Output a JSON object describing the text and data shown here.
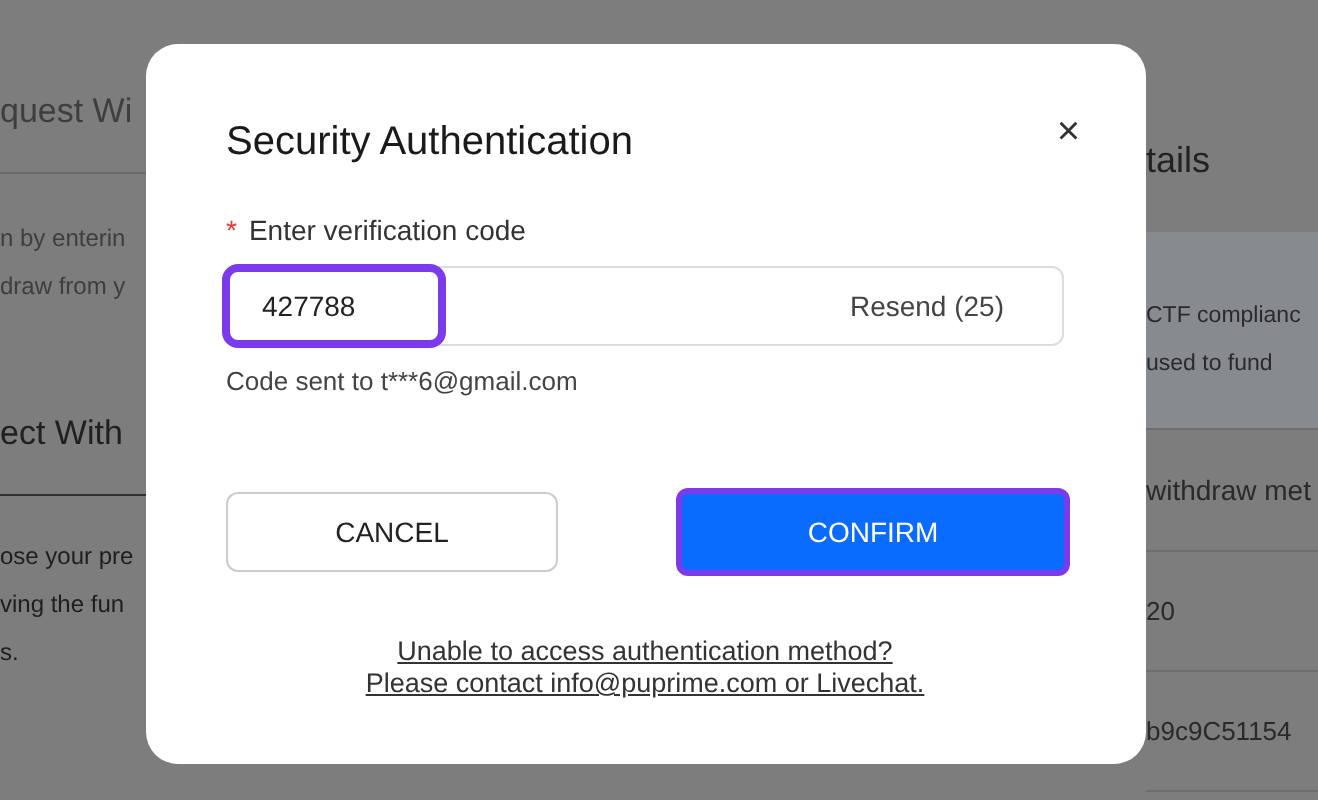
{
  "background": {
    "left": [
      {
        "kind": "heading",
        "text": "quest Wi"
      },
      {
        "kind": "rule"
      },
      {
        "kind": "line",
        "text": "n by enterin"
      },
      {
        "kind": "line",
        "text": "draw from y"
      },
      {
        "kind": "heading",
        "text": "ect With"
      },
      {
        "kind": "rule"
      },
      {
        "kind": "line",
        "text": "ose your pre"
      },
      {
        "kind": "line",
        "text": "ving the fun"
      },
      {
        "kind": "line",
        "text": "s."
      }
    ],
    "right": [
      {
        "kind": "heading",
        "text": "tails"
      },
      {
        "kind": "notice",
        "lines": [
          "CTF complianc",
          "used to fund"
        ]
      },
      {
        "kind": "row",
        "text": "withdraw met"
      },
      {
        "kind": "row",
        "text": "20"
      },
      {
        "kind": "row",
        "text": "b9c9C51154"
      }
    ]
  },
  "dialog": {
    "title": "Security Authentication",
    "close": "×",
    "field": {
      "label": "Enter verification code",
      "required": true,
      "required_mark": "*",
      "value": "427788",
      "highlighted": true,
      "resend": "Resend (25)"
    },
    "hint": "Code sent to t***6@gmail.com",
    "buttons": [
      {
        "kind": "secondary",
        "label": "CANCEL",
        "highlighted": false
      },
      {
        "kind": "primary",
        "label": "CONFIRM",
        "highlighted": true
      }
    ],
    "help": [
      "Unable to access authentication method?",
      "Please contact info@puprime.com or Livechat."
    ]
  }
}
